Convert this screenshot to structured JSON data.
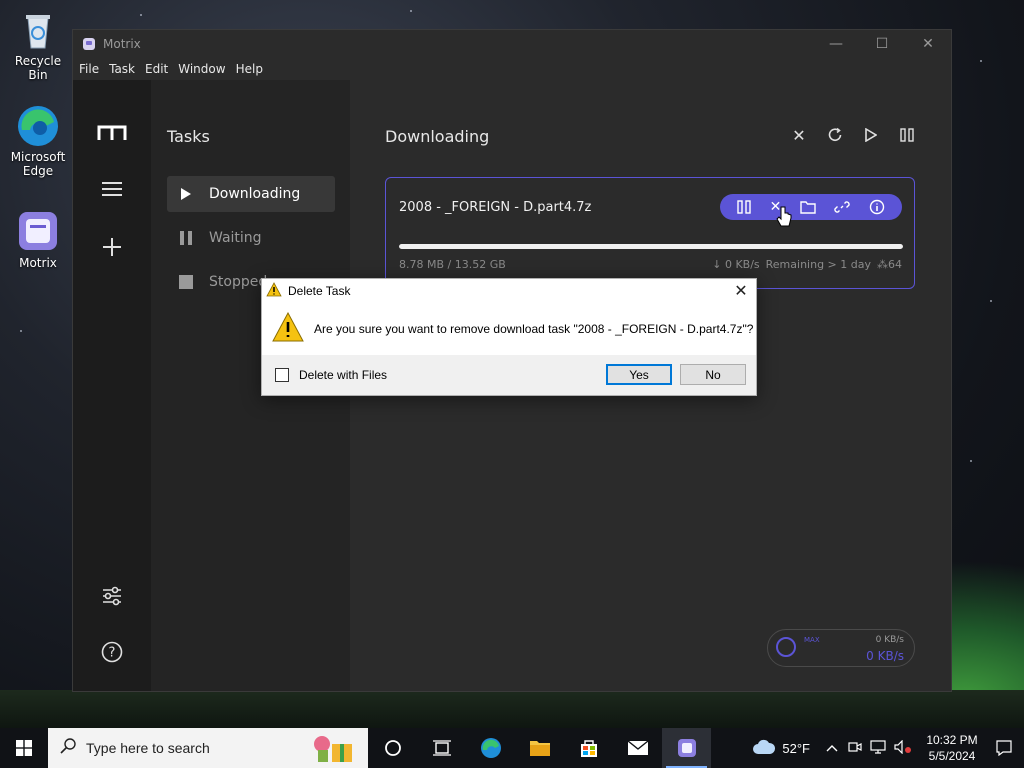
{
  "desktop": {
    "icons": [
      {
        "label": "Recycle Bin"
      },
      {
        "label": "Microsoft Edge"
      },
      {
        "label": "Motrix"
      }
    ]
  },
  "window": {
    "title": "Motrix",
    "menu": [
      "File",
      "Task",
      "Edit",
      "Window",
      "Help"
    ],
    "sidebar": {
      "heading": "Tasks",
      "items": [
        {
          "label": "Downloading",
          "active": true
        },
        {
          "label": "Waiting",
          "active": false
        },
        {
          "label": "Stopped",
          "active": false
        }
      ]
    },
    "main": {
      "title": "Downloading",
      "task": {
        "name": "2008 - _FOREIGN - D.part4.7z",
        "size": "8.78 MB / 13.52 GB",
        "speed": "↓ 0 KB/s",
        "remaining": "Remaining > 1 day",
        "connections": "64",
        "progress": 1.0
      },
      "speed_widget": {
        "label": "MAX",
        "up": "0 KB/s",
        "down": "0 KB/s"
      }
    }
  },
  "dialog": {
    "title": "Delete Task",
    "message": "Are you sure you want to remove download task \"2008 - _FOREIGN - D.part4.7z\"?",
    "checkbox_label": "Delete with Files",
    "yes_label": "Yes",
    "no_label": "No"
  },
  "taskbar": {
    "search_placeholder": "Type here to search",
    "weather": "52°F",
    "time": "10:32 PM",
    "date": "5/5/2024"
  },
  "colors": {
    "accent": "#5b54d6",
    "rail": "#1c1c1c",
    "sidebar": "#242424",
    "main": "#2b2b2b"
  }
}
